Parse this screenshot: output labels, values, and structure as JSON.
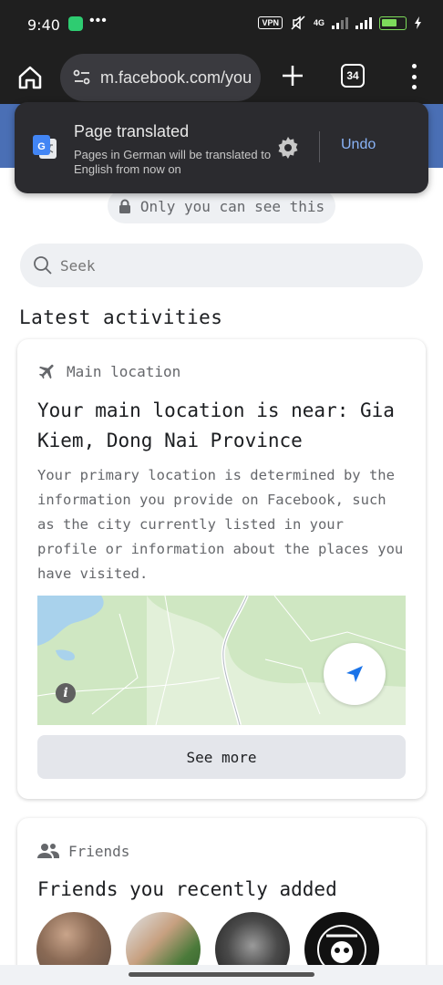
{
  "status_bar": {
    "time": "9:40",
    "dots": "•••",
    "vpn": "VPN",
    "network": "4G",
    "battery_level": "65"
  },
  "browser": {
    "url": "m.facebook.com/you",
    "tab_count": "34"
  },
  "translate_popup": {
    "title": "Page translated",
    "subtitle": "Pages in German will be translated to English from now on",
    "undo_label": "Undo"
  },
  "page": {
    "privacy_label": "Only you can see this",
    "search_placeholder": "Seek",
    "section_title": "Latest activities"
  },
  "location_card": {
    "header": "Main location",
    "heading": "Your main location is near: Gia Kiem, Dong Nai Province",
    "description": "Your primary location is determined by the information you provide on Facebook, such as the city currently listed in your profile or information about the places you have visited.",
    "map_info": "i",
    "see_more_label": "See more"
  },
  "friends_card": {
    "header": "Friends",
    "heading": "Friends you recently added"
  },
  "colors": {
    "facebook_blue": "#4a6fb5",
    "link_blue": "#8ab4f8",
    "map_green": "#cfe7c2",
    "map_water": "#a9d2ec"
  }
}
